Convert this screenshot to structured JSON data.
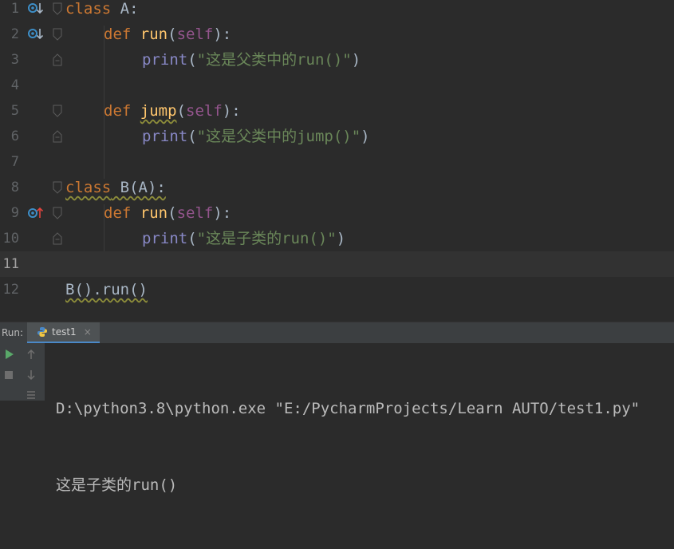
{
  "editor": {
    "lines": [
      {
        "num": "1"
      },
      {
        "num": "2"
      },
      {
        "num": "3"
      },
      {
        "num": "4"
      },
      {
        "num": "5"
      },
      {
        "num": "6"
      },
      {
        "num": "7"
      },
      {
        "num": "8"
      },
      {
        "num": "9"
      },
      {
        "num": "10"
      },
      {
        "num": "11"
      },
      {
        "num": "12"
      }
    ],
    "tokens": {
      "kw_class": "class",
      "kw_def": "def",
      "class_a": " A:",
      "class_b": " B(A):",
      "fn_run": "run",
      "fn_jump": "jump",
      "paren_open": "(",
      "paren_close": "):",
      "self": "self",
      "print": "print",
      "str_run_parent": "\"这是父类中的run()\"",
      "str_jump_parent": "\"这是父类中的jump()\"",
      "str_run_child": "\"这是子类的run()\"",
      "call_close": ")",
      "call_line": "B().run()"
    }
  },
  "run_panel": {
    "label": "Run:",
    "tab_label": "test1",
    "close_glyph": "×",
    "console_lines": [
      "D:\\python3.8\\python.exe \"E:/PycharmProjects/Learn AUTO/test1.py\"",
      "这是子类的run()"
    ]
  },
  "colors": {
    "keyword": "#cc7832",
    "function": "#ffc66d",
    "self": "#94558d",
    "string": "#6a8759",
    "builtin": "#8888c6",
    "accent": "#4a88c7"
  }
}
